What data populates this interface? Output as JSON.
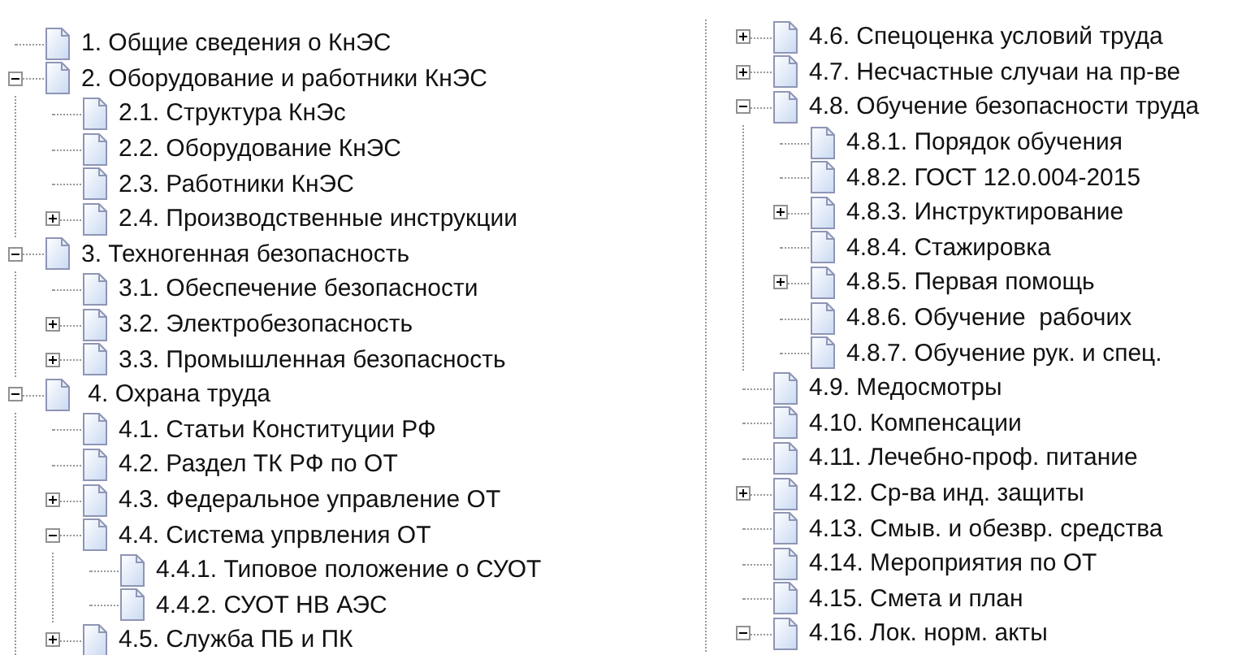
{
  "columns": [
    {
      "kind": "root",
      "nodes": [
        {
          "label": "1. Общие сведения о КнЭС"
        },
        {
          "label": "2. Оборудование и работники КнЭС",
          "expanded": true,
          "children": [
            {
              "label": "2.1. Структура КнЭс"
            },
            {
              "label": "2.2. Оборудование КнЭС"
            },
            {
              "label": "2.3. Работники КнЭС"
            },
            {
              "label": "2.4. Производственные инструкции",
              "expanded": false
            }
          ]
        },
        {
          "label": "3. Техногенная безопасность",
          "expanded": true,
          "children": [
            {
              "label": "3.1. Обеспечение безопасности"
            },
            {
              "label": "3.2. Электробезопасность",
              "expanded": false
            },
            {
              "label": "3.3. Промышленная безопасность",
              "expanded": false
            }
          ]
        },
        {
          "label": " 4. Охрана труда",
          "expanded": true,
          "children": [
            {
              "label": "4.1. Статьи Конституции РФ"
            },
            {
              "label": "4.2. Раздел ТК РФ по ОТ"
            },
            {
              "label": "4.3. Федеральное управление ОТ",
              "expanded": false
            },
            {
              "label": "4.4. Система упрвления ОТ",
              "expanded": true,
              "children": [
                {
                  "label": "4.4.1. Типовое положение о СУОТ"
                },
                {
                  "label": "4.4.2. СУОТ НВ АЭС"
                }
              ]
            },
            {
              "label": "4.5. Служба ПБ и ПК",
              "expanded": false
            }
          ]
        }
      ]
    },
    {
      "kind": "continuation",
      "nodes": [
        {
          "label": "4.6. Спецоценка условий труда",
          "expanded": false
        },
        {
          "label": "4.7. Несчастные случаи на пр-ве",
          "expanded": false
        },
        {
          "label": "4.8. Обучение безопасности труда",
          "expanded": true,
          "children": [
            {
              "label": "4.8.1. Порядок обучения"
            },
            {
              "label": "4.8.2. ГОСТ 12.0.004-2015"
            },
            {
              "label": "4.8.3. Инструктирование",
              "expanded": false
            },
            {
              "label": "4.8.4. Стажировка"
            },
            {
              "label": "4.8.5. Первая помощь",
              "expanded": false
            },
            {
              "label": "4.8.6. Обучение  рабочих"
            },
            {
              "label": "4.8.7. Обучение рук. и спец."
            }
          ]
        },
        {
          "label": "4.9. Медосмотры"
        },
        {
          "label": "4.10. Компенсации"
        },
        {
          "label": "4.11. Лечебно-проф. питание"
        },
        {
          "label": "4.12. Ср-ва инд. защиты",
          "expanded": false
        },
        {
          "label": "4.13. Смыв. и обезвр. средства"
        },
        {
          "label": "4.14. Мероприятия по ОТ"
        },
        {
          "label": "4.15. Смета и план"
        },
        {
          "label": "4.16. Лок. норм. акты",
          "expanded": true
        }
      ]
    }
  ]
}
